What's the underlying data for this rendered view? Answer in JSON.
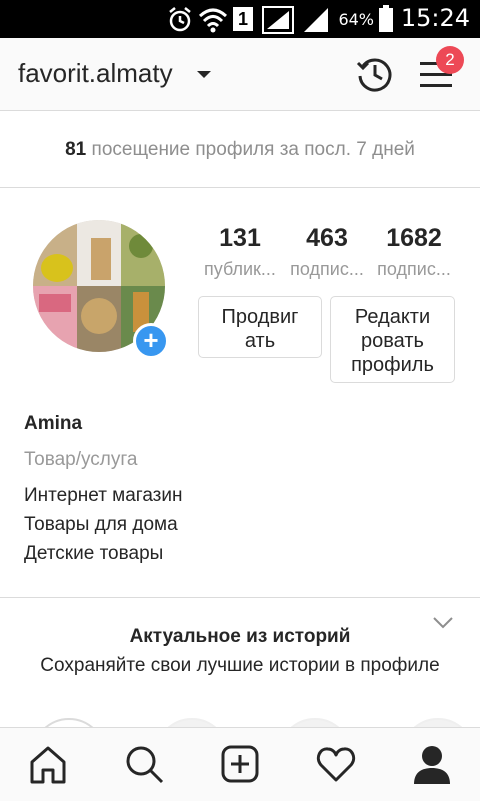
{
  "status_bar": {
    "time": "15:24",
    "battery": "64%",
    "sim_slot": "1"
  },
  "header": {
    "username": "favorit.almaty",
    "notification_count": "2"
  },
  "visits": {
    "count": "81",
    "label": "посещение профиля за посл. 7 дней"
  },
  "stats": [
    {
      "value": "131",
      "label": "публик..."
    },
    {
      "value": "463",
      "label": "подпис..."
    },
    {
      "value": "1682",
      "label": "подпис..."
    }
  ],
  "buttons": {
    "promote": [
      "Продвиг",
      "ать"
    ],
    "edit": [
      "Редакти",
      "ровать",
      "профиль"
    ]
  },
  "bio": {
    "name": "Amina",
    "category": "Товар/услуга",
    "lines": [
      "Интернет магазин",
      "Товары для дома",
      "Детские товары"
    ]
  },
  "highlights": {
    "title": "Актуальное из историй",
    "subtitle": "Сохраняйте свои лучшие истории в профиле"
  },
  "tabbar": [
    "home-icon",
    "search-icon",
    "add-icon",
    "heart-icon",
    "profile-icon"
  ]
}
